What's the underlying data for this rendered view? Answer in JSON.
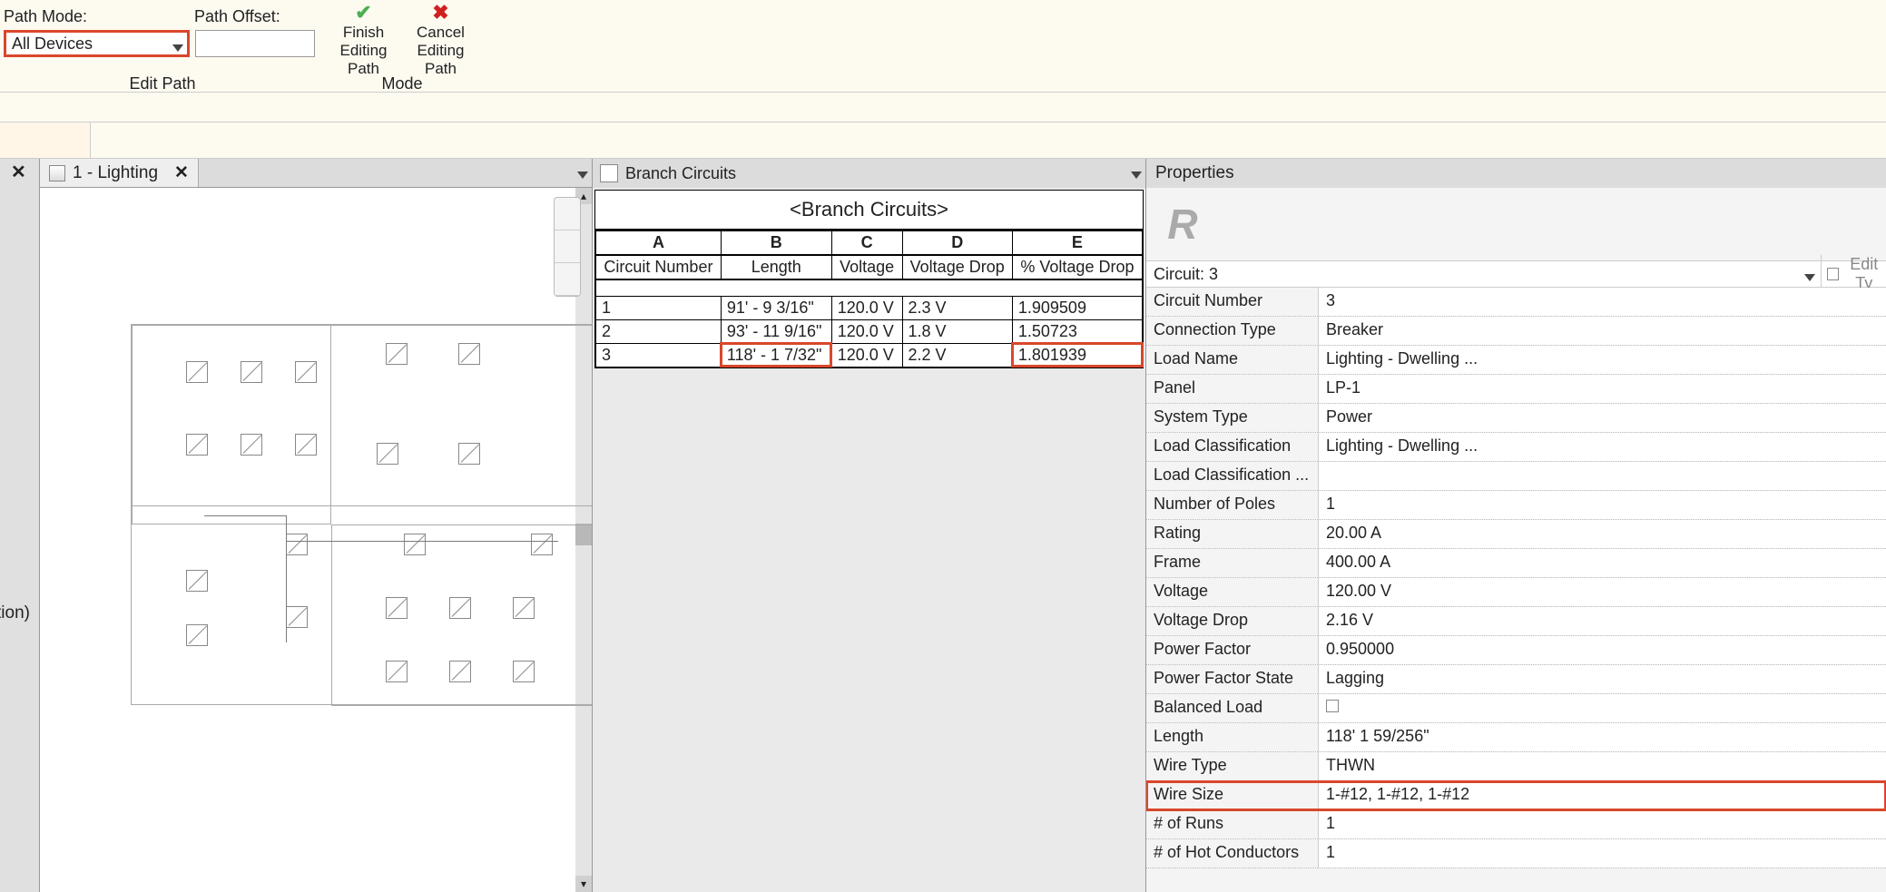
{
  "ribbon": {
    "path_mode_label": "Path Mode:",
    "path_offset_label": "Path Offset:",
    "path_mode_value": "All Devices",
    "path_offset_value": "",
    "finish_label": "Finish\nEditing Path",
    "cancel_label": "Cancel\nEditing Path",
    "group_editpath": "Edit Path",
    "group_mode": "Mode"
  },
  "left": {
    "side_text": "tion)"
  },
  "view_tab": {
    "title": "1 - Lighting"
  },
  "schedule": {
    "tab_title": "Branch Circuits",
    "title": "<Branch Circuits>",
    "cols_letters": [
      "A",
      "B",
      "C",
      "D",
      "E"
    ],
    "cols": [
      "Circuit Number",
      "Length",
      "Voltage",
      "Voltage Drop",
      "% Voltage Drop"
    ],
    "rows": [
      {
        "n": "1",
        "len": "91' - 9 3/16\"",
        "v": "120.0 V",
        "vd": "2.3 V",
        "pct": "1.909509",
        "hl": false
      },
      {
        "n": "2",
        "len": "93' - 11 9/16\"",
        "v": "120.0 V",
        "vd": "1.8 V",
        "pct": "1.50723",
        "hl": false
      },
      {
        "n": "3",
        "len": "118' - 1 7/32\"",
        "v": "120.0 V",
        "vd": "2.2 V",
        "pct": "1.801939",
        "hl": true
      }
    ]
  },
  "properties": {
    "panel_title": "Properties",
    "type_selector": "Circuit: 3",
    "edit_type_label": "Edit Ty",
    "rows": [
      {
        "k": "Circuit Number",
        "v": "3"
      },
      {
        "k": "Connection Type",
        "v": "Breaker"
      },
      {
        "k": "Load Name",
        "v": "Lighting - Dwelling ..."
      },
      {
        "k": "Panel",
        "v": "LP-1"
      },
      {
        "k": "System Type",
        "v": "Power"
      },
      {
        "k": "Load Classification",
        "v": "Lighting - Dwelling ..."
      },
      {
        "k": "Load Classification ...",
        "v": ""
      },
      {
        "k": "Number of Poles",
        "v": "1"
      },
      {
        "k": "Rating",
        "v": "20.00 A"
      },
      {
        "k": "Frame",
        "v": "400.00 A"
      },
      {
        "k": "Voltage",
        "v": "120.00 V"
      },
      {
        "k": "Voltage Drop",
        "v": "2.16 V"
      },
      {
        "k": "Power Factor",
        "v": "0.950000"
      },
      {
        "k": "Power Factor State",
        "v": "Lagging"
      },
      {
        "k": "Balanced Load",
        "v": "[checkbox]"
      },
      {
        "k": "Length",
        "v": "118'  1 59/256\""
      },
      {
        "k": "Wire Type",
        "v": "THWN"
      },
      {
        "k": "Wire Size",
        "v": "1-#12, 1-#12, 1-#12",
        "hl": true
      },
      {
        "k": "# of Runs",
        "v": "1"
      },
      {
        "k": "# of Hot Conductors",
        "v": "1"
      }
    ]
  }
}
